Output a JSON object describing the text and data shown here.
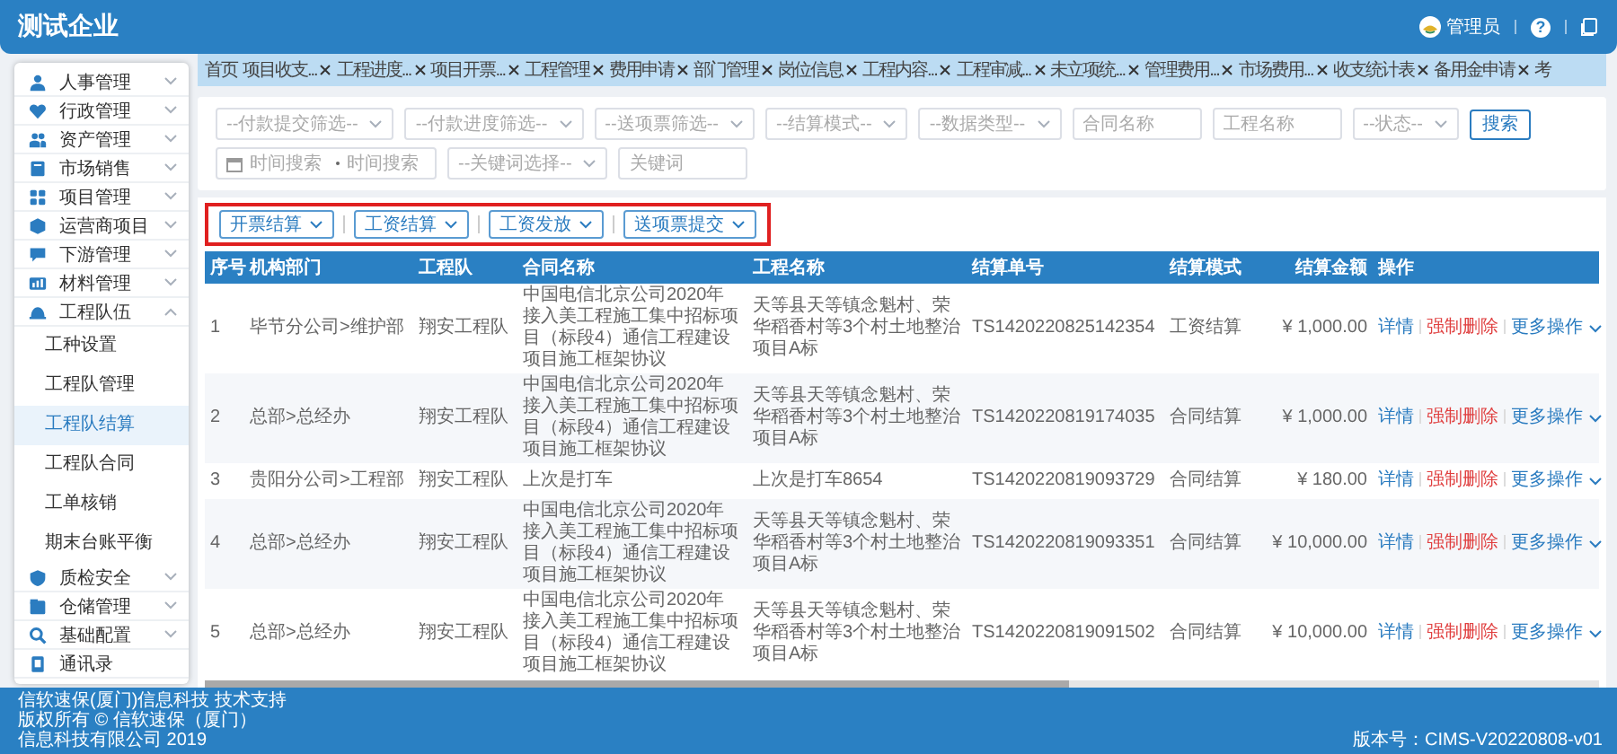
{
  "header": {
    "title": "测试企业",
    "user": "管理员",
    "help": "?"
  },
  "sidebar": {
    "items": [
      {
        "label": "人事管理",
        "kind": "group",
        "expanded": false
      },
      {
        "label": "行政管理",
        "kind": "group",
        "expanded": false
      },
      {
        "label": "资产管理",
        "kind": "group",
        "expanded": false
      },
      {
        "label": "市场销售",
        "kind": "group",
        "expanded": false
      },
      {
        "label": "项目管理",
        "kind": "group",
        "expanded": false
      },
      {
        "label": "运营商项目",
        "kind": "group",
        "expanded": false
      },
      {
        "label": "下游管理",
        "kind": "group",
        "expanded": false
      },
      {
        "label": "材料管理",
        "kind": "group",
        "expanded": false
      },
      {
        "label": "工程队伍",
        "kind": "group",
        "expanded": true,
        "children": [
          {
            "label": "工种设置",
            "selected": false
          },
          {
            "label": "工程队管理",
            "selected": false
          },
          {
            "label": "工程队结算",
            "selected": true
          },
          {
            "label": "工程队合同",
            "selected": false
          },
          {
            "label": "工单核销",
            "selected": false
          },
          {
            "label": "期末台账平衡",
            "selected": false
          }
        ]
      },
      {
        "label": "质检安全",
        "kind": "group",
        "expanded": false
      },
      {
        "label": "仓储管理",
        "kind": "group",
        "expanded": false
      },
      {
        "label": "基础配置",
        "kind": "group",
        "expanded": false
      },
      {
        "label": "通讯录",
        "kind": "link"
      }
    ]
  },
  "tabs": [
    {
      "label": "首页",
      "closable": false
    },
    {
      "label": "项目收支...",
      "closable": true
    },
    {
      "label": "工程进度...",
      "closable": true
    },
    {
      "label": "项目开票...",
      "closable": true
    },
    {
      "label": "工程管理",
      "closable": true
    },
    {
      "label": "费用申请",
      "closable": true
    },
    {
      "label": "部门管理",
      "closable": true
    },
    {
      "label": "岗位信息",
      "closable": true
    },
    {
      "label": "工程内容...",
      "closable": true
    },
    {
      "label": "工程审减...",
      "closable": true
    },
    {
      "label": "未立项统...",
      "closable": true
    },
    {
      "label": "管理费用...",
      "closable": true
    },
    {
      "label": "市场费用...",
      "closable": true
    },
    {
      "label": "收支统计表",
      "closable": true
    },
    {
      "label": "备用金申请",
      "closable": true
    },
    {
      "label": "考",
      "closable": false
    }
  ],
  "filter_rows": [
    {
      "fields": [
        {
          "kind": "select",
          "placeholder": "--付款提交筛选--"
        },
        {
          "kind": "select",
          "placeholder": "--付款进度筛选--"
        },
        {
          "kind": "select",
          "placeholder": "--送项票筛选--"
        },
        {
          "kind": "select",
          "placeholder": "--结算模式--"
        },
        {
          "kind": "select",
          "placeholder": "--数据类型--"
        },
        {
          "kind": "input",
          "placeholder": "合同名称"
        },
        {
          "kind": "input",
          "placeholder": "工程名称"
        },
        {
          "kind": "select",
          "placeholder": "--状态--"
        },
        {
          "kind": "button",
          "label": "搜索"
        }
      ]
    },
    {
      "fields": [
        {
          "kind": "date-range",
          "placeholder": "时间搜索",
          "placeholder_end": "时间搜索"
        },
        {
          "kind": "select",
          "placeholder": "--关键词选择--"
        },
        {
          "kind": "input",
          "placeholder": "关键词"
        }
      ]
    }
  ],
  "toolbar": {
    "highlighted": true,
    "buttons": [
      {
        "label": "开票结算"
      },
      {
        "label": "工资结算"
      },
      {
        "label": "工资发放"
      },
      {
        "label": "送项票提交"
      }
    ]
  },
  "table": {
    "columns": [
      "序号",
      "机构部门",
      "工程队",
      "合同名称",
      "工程名称",
      "结算单号",
      "结算模式",
      "结算金额",
      "操作"
    ],
    "rows": [
      {
        "cells": [
          "1",
          "毕节分公司>维护部",
          "翔安工程队",
          "中国电信北京公司2020年接入美工程施工集中招标项目（标段4）通信工程建设项目施工框架协议",
          "天等县天等镇念魁村、荣华稻香村等3个村土地整治项目A标",
          "TS1420220825142354",
          "工资结算",
          "¥ 1,000.00"
        ],
        "actions": [
          {
            "label": "详情",
            "kind": "link"
          },
          {
            "label": "强制删除",
            "kind": "danger"
          },
          {
            "label": "更多操作",
            "kind": "menu"
          }
        ]
      },
      {
        "cells": [
          "2",
          "总部>总经办",
          "翔安工程队",
          "中国电信北京公司2020年接入美工程施工集中招标项目（标段4）通信工程建设项目施工框架协议",
          "天等县天等镇念魁村、荣华稻香村等3个村土地整治项目A标",
          "TS1420220819174035",
          "合同结算",
          "¥ 1,000.00"
        ],
        "actions": [
          {
            "label": "详情",
            "kind": "link"
          },
          {
            "label": "强制删除",
            "kind": "danger"
          },
          {
            "label": "更多操作",
            "kind": "menu"
          }
        ]
      },
      {
        "cells": [
          "3",
          "贵阳分公司>工程部",
          "翔安工程队",
          "上次是打车",
          "上次是打车8654",
          "TS1420220819093729",
          "合同结算",
          "¥ 180.00"
        ],
        "actions": [
          {
            "label": "详情",
            "kind": "link"
          },
          {
            "label": "强制删除",
            "kind": "danger"
          },
          {
            "label": "更多操作",
            "kind": "menu"
          }
        ]
      },
      {
        "cells": [
          "4",
          "总部>总经办",
          "翔安工程队",
          "中国电信北京公司2020年接入美工程施工集中招标项目（标段4）通信工程建设项目施工框架协议",
          "天等县天等镇念魁村、荣华稻香村等3个村土地整治项目A标",
          "TS1420220819093351",
          "合同结算",
          "¥ 10,000.00"
        ],
        "actions": [
          {
            "label": "详情",
            "kind": "link"
          },
          {
            "label": "强制删除",
            "kind": "danger"
          },
          {
            "label": "更多操作",
            "kind": "menu"
          }
        ]
      },
      {
        "cells": [
          "5",
          "总部>总经办",
          "翔安工程队",
          "中国电信北京公司2020年接入美工程施工集中招标项目（标段4）通信工程建设项目施工框架协议",
          "天等县天等镇念魁村、荣华稻香村等3个村土地整治项目A标",
          "TS1420220819091502",
          "合同结算",
          "¥ 10,000.00"
        ],
        "actions": [
          {
            "label": "详情",
            "kind": "link"
          },
          {
            "label": "强制删除",
            "kind": "danger"
          },
          {
            "label": "更多操作",
            "kind": "menu"
          }
        ]
      }
    ]
  },
  "footer": {
    "lines": [
      "信软速保(厦门)信息科技 技术支持",
      "版权所有 © 信软速保（厦门）",
      "信息科技有限公司 2019"
    ],
    "version": "版本号：CIMS-V20220808-v01"
  }
}
